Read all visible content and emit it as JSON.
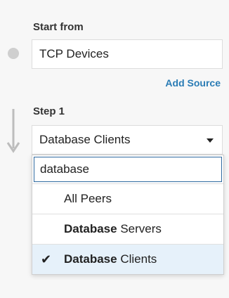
{
  "start": {
    "label": "Start from",
    "source_value": "TCP Devices",
    "add_source": "Add Source"
  },
  "step": {
    "label": "Step 1",
    "selected_value": "Database Clients"
  },
  "dropdown": {
    "search_value": "database",
    "options": [
      {
        "bold": "",
        "rest": "All Peers",
        "checked": false
      },
      {
        "bold": "Database",
        "rest": " Servers",
        "checked": false
      },
      {
        "bold": "Database",
        "rest": " Clients",
        "checked": true
      }
    ]
  },
  "icons": {
    "check": "✔"
  }
}
